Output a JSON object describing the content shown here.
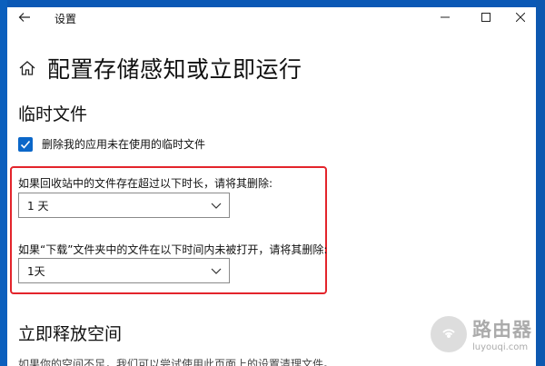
{
  "window": {
    "title": "设置"
  },
  "page": {
    "title": "配置存储感知或立即运行"
  },
  "temp_files": {
    "heading": "临时文件",
    "checkbox_label": "删除我的应用未在使用的临时文件",
    "checkbox_checked": true,
    "recycle_label": "如果回收站中的文件存在超过以下时长，请将其删除:",
    "recycle_value": "1 天",
    "downloads_label": "如果“下载”文件夹中的文件在以下时间内未被打开，请将其删除:",
    "downloads_value": "1天"
  },
  "free_space": {
    "heading": "立即释放空间",
    "description": "如果你的空间不足，我们可以尝试使用此页面上的设置清理文件。"
  },
  "watermark": {
    "name": "路由器",
    "url": "luyouqi.com"
  },
  "colors": {
    "accent": "#0b67c9",
    "highlight": "#e3242b",
    "desktop": "#1f6fc7"
  },
  "icons": {
    "back": "back-arrow-icon",
    "home": "home-icon",
    "chevron": "chevron-down-icon"
  }
}
